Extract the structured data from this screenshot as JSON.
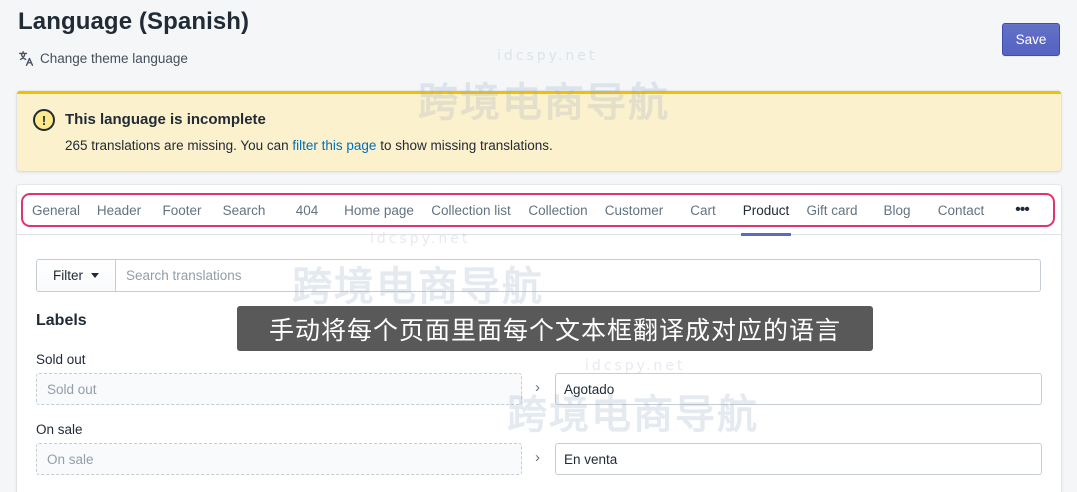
{
  "header": {
    "title": "Language (Spanish)",
    "secondary_action": "Change theme language",
    "save_label": "Save"
  },
  "banner": {
    "title": "This language is incomplete",
    "text_before": "265 translations are missing. You can ",
    "link": "filter this page",
    "text_after": " to show missing translations."
  },
  "tabs": [
    {
      "label": "General"
    },
    {
      "label": "Header"
    },
    {
      "label": "Footer"
    },
    {
      "label": "Search"
    },
    {
      "label": "404"
    },
    {
      "label": "Home page"
    },
    {
      "label": "Collection list"
    },
    {
      "label": "Collection"
    },
    {
      "label": "Customer"
    },
    {
      "label": "Cart"
    },
    {
      "label": "Product",
      "active": true
    },
    {
      "label": "Gift card"
    },
    {
      "label": "Blog"
    },
    {
      "label": "Contact"
    },
    {
      "label": "•••"
    }
  ],
  "filter": {
    "button_label": "Filter",
    "search_placeholder": "Search translations"
  },
  "section": {
    "title": "Labels",
    "fields": [
      {
        "label": "Sold out",
        "source": "Sold out",
        "translation": "Agotado"
      },
      {
        "label": "On sale",
        "source": "On sale",
        "translation": "En venta"
      }
    ]
  },
  "overlay": {
    "subtitle": "手动将每个页面里面每个文本框翻译成对应的语言"
  },
  "watermark": {
    "cn": "跨境电商导航",
    "en": "idcspy.net"
  },
  "colors": {
    "primary": "#5c6ac4",
    "banner_bg": "#fcf1cd",
    "banner_border": "#eec200",
    "highlight": "#e0336f",
    "link": "#006fbb"
  }
}
